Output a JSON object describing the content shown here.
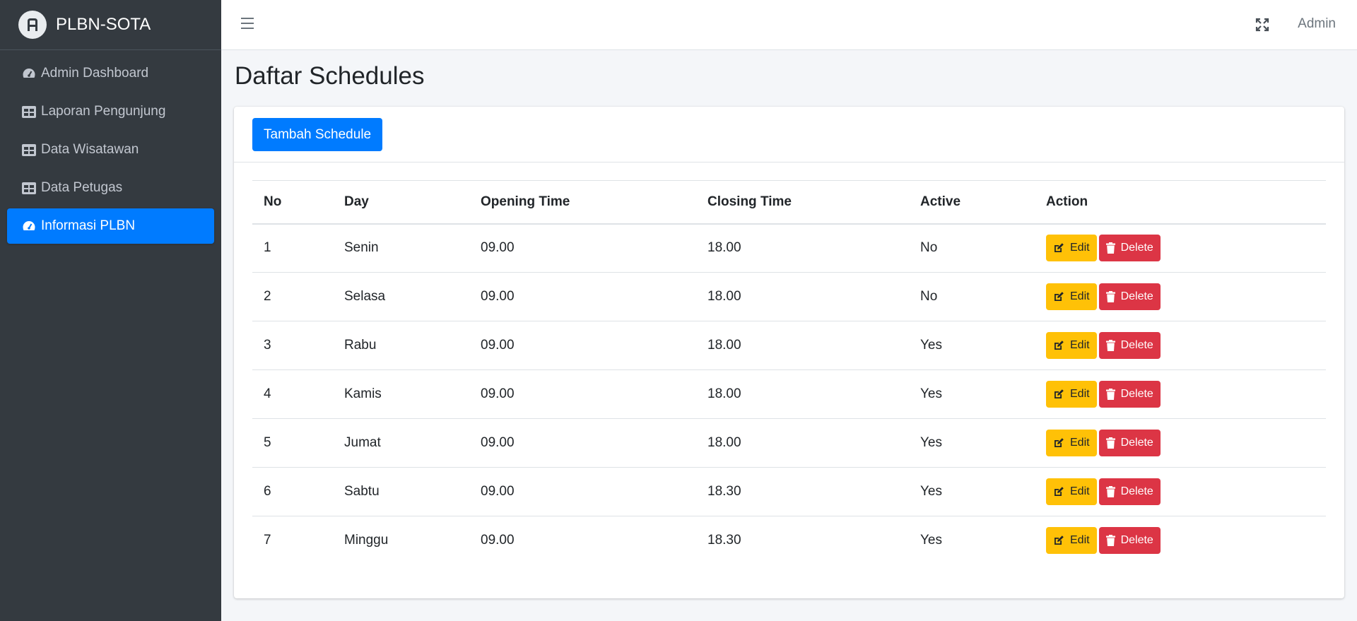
{
  "brand": {
    "name": "PLBN-SOTA"
  },
  "sidebar": {
    "items": [
      {
        "label": "Admin Dashboard",
        "icon": "tachometer-icon",
        "active": false
      },
      {
        "label": "Laporan Pengunjung",
        "icon": "table-icon",
        "active": false
      },
      {
        "label": "Data Wisatawan",
        "icon": "table-icon",
        "active": false
      },
      {
        "label": "Data Petugas",
        "icon": "table-icon",
        "active": false
      },
      {
        "label": "Informasi PLBN",
        "icon": "tachometer-icon",
        "active": true
      }
    ]
  },
  "header": {
    "user": "Admin"
  },
  "page": {
    "title": "Daftar Schedules",
    "add_button": "Tambah Schedule"
  },
  "table": {
    "columns": [
      "No",
      "Day",
      "Opening Time",
      "Closing Time",
      "Active",
      "Action"
    ],
    "rows": [
      {
        "no": "1",
        "day": "Senin",
        "open": "09.00",
        "close": "18.00",
        "active": "No"
      },
      {
        "no": "2",
        "day": "Selasa",
        "open": "09.00",
        "close": "18.00",
        "active": "No"
      },
      {
        "no": "3",
        "day": "Rabu",
        "open": "09.00",
        "close": "18.00",
        "active": "Yes"
      },
      {
        "no": "4",
        "day": "Kamis",
        "open": "09.00",
        "close": "18.00",
        "active": "Yes"
      },
      {
        "no": "5",
        "day": "Jumat",
        "open": "09.00",
        "close": "18.00",
        "active": "Yes"
      },
      {
        "no": "6",
        "day": "Sabtu",
        "open": "09.00",
        "close": "18.30",
        "active": "Yes"
      },
      {
        "no": "7",
        "day": "Minggu",
        "open": "09.00",
        "close": "18.30",
        "active": "Yes"
      }
    ],
    "edit_label": "Edit",
    "delete_label": "Delete"
  },
  "colors": {
    "primary": "#007bff",
    "warning": "#ffc107",
    "danger": "#dc3545",
    "sidebar": "#343a40"
  }
}
